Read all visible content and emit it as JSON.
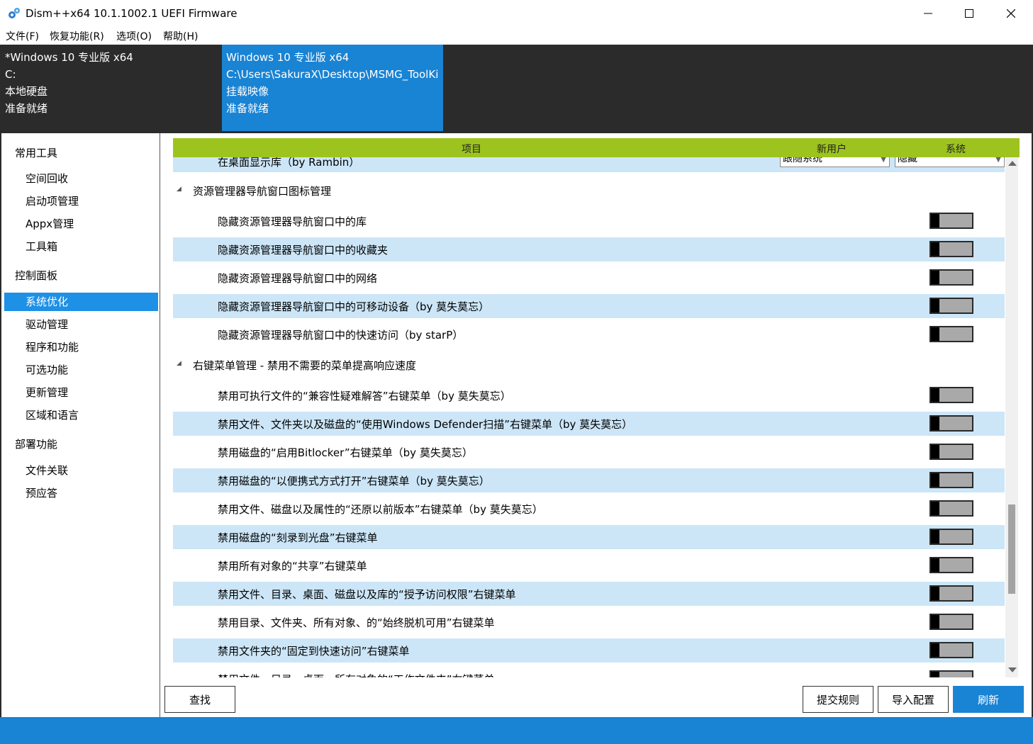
{
  "window": {
    "title": "Dism++x64 10.1.1002.1 UEFI Firmware",
    "icon": "gears-icon"
  },
  "menu": [
    {
      "label": "文件(F)"
    },
    {
      "label": "恢复功能(R)"
    },
    {
      "label": "选项(O)"
    },
    {
      "label": "帮助(H)"
    }
  ],
  "images": [
    {
      "name": "*Windows 10 专业版 x64",
      "path": "C:",
      "type": "本地硬盘",
      "status": "准备就绪"
    },
    {
      "name": "Windows 10 专业版 x64",
      "path": "C:\\Users\\SakuraX\\Desktop\\MSMG_ToolKi",
      "type": "挂载映像",
      "status": "准备就绪"
    }
  ],
  "sidebar": {
    "categories": [
      {
        "label": "常用工具",
        "items": [
          "空间回收",
          "启动项管理",
          "Appx管理",
          "工具箱"
        ]
      },
      {
        "label": "控制面板",
        "items": [
          "系统优化",
          "驱动管理",
          "程序和功能",
          "可选功能",
          "更新管理",
          "区域和语言"
        ]
      },
      {
        "label": "部署功能",
        "items": [
          "文件关联",
          "预应答"
        ]
      }
    ],
    "active": "系统优化"
  },
  "table": {
    "headers": {
      "item": "项目",
      "new_user": "新用户",
      "system": "系统"
    },
    "partial_top_row": {
      "label": "在桌面显示库（by Rambin）",
      "new_user_value": "跟随系统",
      "system_value": "隐藏"
    },
    "groups": [
      {
        "label": "资源管理器导航窗口图标管理",
        "items": [
          "隐藏资源管理器导航窗口中的库",
          "隐藏资源管理器导航窗口中的收藏夹",
          "隐藏资源管理器导航窗口中的网络",
          "隐藏资源管理器导航窗口中的可移动设备（by 莫失莫忘）",
          "隐藏资源管理器导航窗口中的快速访问（by starP）"
        ]
      },
      {
        "label": "右键菜单管理 - 禁用不需要的菜单提高响应速度",
        "items": [
          "禁用可执行文件的“兼容性疑难解答”右键菜单（by 莫失莫忘）",
          "禁用文件、文件夹以及磁盘的“使用Windows Defender扫描”右键菜单（by 莫失莫忘）",
          "禁用磁盘的“启用Bitlocker”右键菜单（by 莫失莫忘）",
          "禁用磁盘的“以便携式方式打开”右键菜单（by 莫失莫忘）",
          "禁用文件、磁盘以及属性的“还原以前版本”右键菜单（by 莫失莫忘）",
          "禁用磁盘的“刻录到光盘”右键菜单",
          "禁用所有对象的“共享”右键菜单",
          "禁用文件、目录、桌面、磁盘以及库的“授予访问权限”右键菜单",
          "禁用目录、文件夹、所有对象、的“始终脱机可用”右键菜单",
          "禁用文件夹的“固定到快速访问”右键菜单",
          "禁用文件、目录、桌面、所有对象的“工作文件夹”右键菜单"
        ]
      }
    ]
  },
  "buttons": {
    "find": "查找",
    "submit_rules": "提交规则",
    "import_config": "导入配置",
    "refresh": "刷新"
  },
  "colors": {
    "accent": "#1983d4",
    "header_green": "#9dc41e",
    "row_alt": "#cce6f8",
    "dark": "#2b2b2b"
  }
}
